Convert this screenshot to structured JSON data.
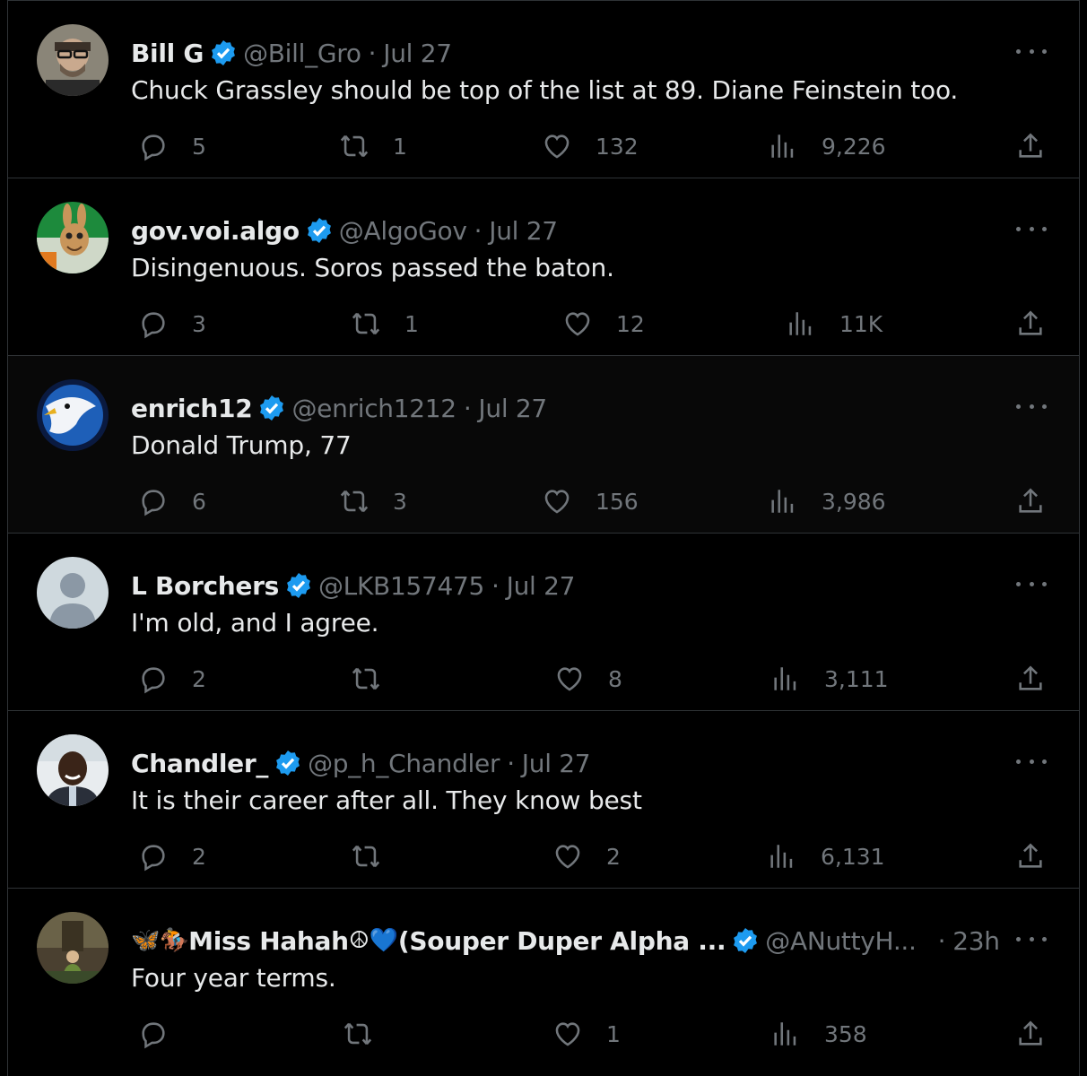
{
  "colors": {
    "background": "#000000",
    "text": "#e7e9ea",
    "muted": "#71767b",
    "verified": "#1d9bf0",
    "border": "#2f3336"
  },
  "icons": {
    "reply": "reply-icon",
    "retweet": "retweet-icon",
    "like": "heart-icon",
    "views": "views-chart-icon",
    "share": "share-icon",
    "more": "more-icon",
    "verified": "verified-badge-icon"
  },
  "tweets": [
    {
      "name": "Bill G",
      "handle": "@Bill_Gro",
      "sep": "·",
      "time": "Jul 27",
      "text": "Chuck Grassley should be top of the list at 89.  Diane Feinstein too.",
      "replies": "5",
      "retweets": "1",
      "likes": "132",
      "views": "9,226"
    },
    {
      "name": "gov.voi.algo",
      "handle": "@AlgoGov",
      "sep": "·",
      "time": "Jul 27",
      "text": "Disingenuous. Soros passed the baton.",
      "replies": "3",
      "retweets": "1",
      "likes": "12",
      "views": "11K"
    },
    {
      "name": "enrich12",
      "handle": "@enrich1212",
      "sep": "·",
      "time": "Jul 27",
      "text": "Donald Trump, 77",
      "replies": "6",
      "retweets": "3",
      "likes": "156",
      "views": "3,986"
    },
    {
      "name": "L Borchers",
      "handle": "@LKB157475",
      "sep": "·",
      "time": "Jul 27",
      "text": "I'm old, and I agree.",
      "replies": "2",
      "retweets": "",
      "likes": "8",
      "views": "3,111"
    },
    {
      "name": "Chandler_",
      "handle": "@p_h_Chandler",
      "sep": "·",
      "time": "Jul 27",
      "text": "It is their career after all. They know best",
      "replies": "2",
      "retweets": "",
      "likes": "2",
      "views": "6,131"
    },
    {
      "name_prefix": "🦋🏇",
      "name": "Miss Hahah",
      "name_emoji": "☮💙",
      "name_suffix": "(Souper Duper Alpha ...",
      "handle": "@ANuttyH...",
      "sep": "·",
      "time": "23h",
      "text": "Four year terms.",
      "replies": "",
      "retweets": "",
      "likes": "1",
      "views": "358"
    }
  ]
}
